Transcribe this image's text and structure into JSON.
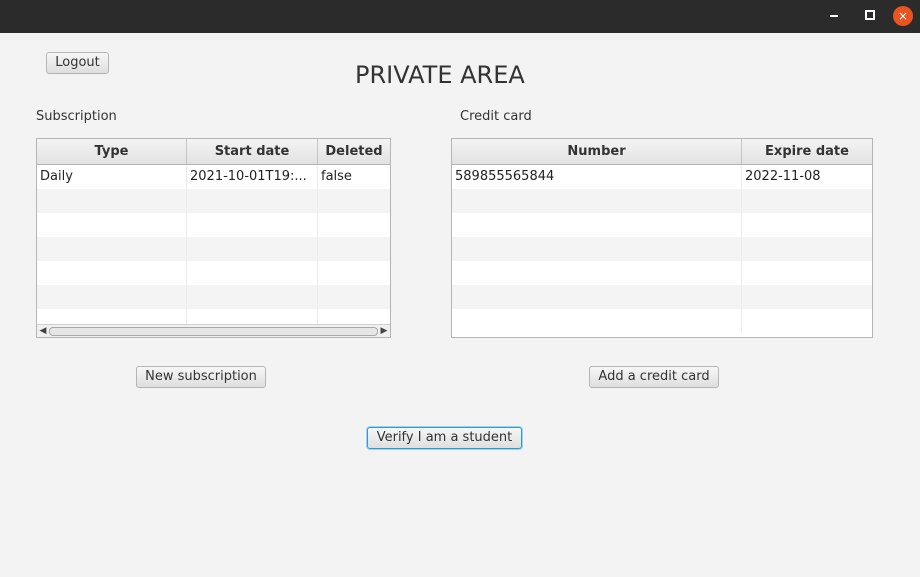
{
  "window": {
    "minimize": "—",
    "maximize": "",
    "close": "×"
  },
  "header": {
    "title": "PRIVATE AREA",
    "logout_label": "Logout"
  },
  "subscription": {
    "label": "Subscription",
    "columns": [
      "Type",
      "Start date",
      "Deleted"
    ],
    "rows": [
      [
        "Daily",
        "2021-10-01T19:...",
        "false"
      ]
    ],
    "new_button": "New subscription"
  },
  "credit_card": {
    "label": "Credit card",
    "columns": [
      "Number",
      "Expire date"
    ],
    "rows": [
      [
        "589855565844",
        "2022-11-08"
      ]
    ],
    "add_button": "Add a credit card"
  },
  "verify_button": "Verify I am a student"
}
